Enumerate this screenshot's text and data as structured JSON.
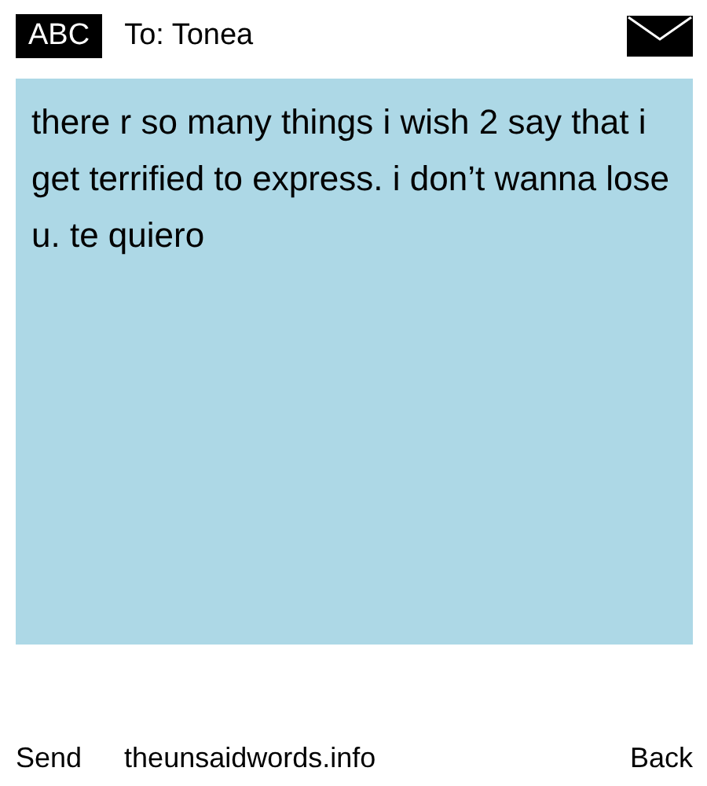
{
  "header": {
    "input_mode": "ABC",
    "recipient": "To: Tonea"
  },
  "message": {
    "text": "there r so many things i wish 2 say that i get terrified to express. i don’t wanna lose u. te quiero"
  },
  "footer": {
    "left": "Send",
    "center": "theunsaidwords.info",
    "right": "Back"
  }
}
